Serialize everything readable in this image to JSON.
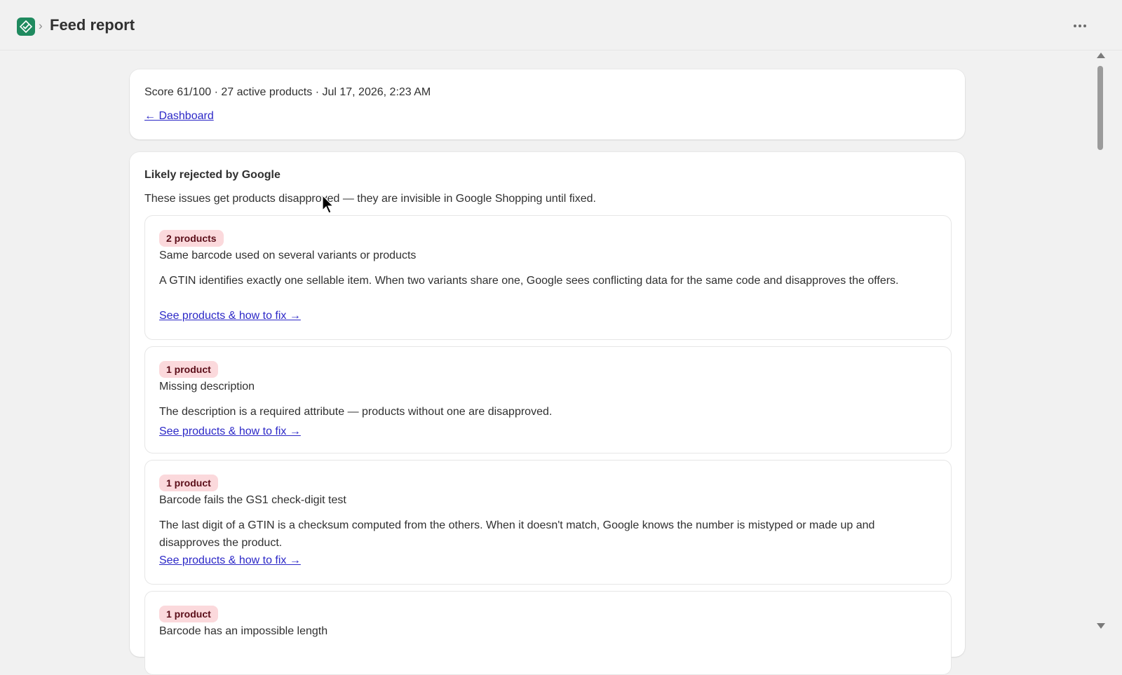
{
  "header": {
    "breadcrumb_sep": "›",
    "title": "Feed report"
  },
  "summary": {
    "line": "Score 61/100 · 27 active products · Jul 17, 2026, 2:23 AM",
    "dashboard_link": "← Dashboard"
  },
  "section": {
    "title": "Likely rejected by Google",
    "description": "These issues get products disapproved — they are invisible in Google Shopping until fixed."
  },
  "issues": [
    {
      "badge": "2 products",
      "title": "Same barcode used on several variants or products",
      "description": "A GTIN identifies exactly one sellable item. When two variants share one, Google sees conflicting data for the same code and disapproves the offers.",
      "link": "See products & how to fix →"
    },
    {
      "badge": "1 product",
      "title": "Missing description",
      "description": "The description is a required attribute — products without one are disapproved.",
      "link": "See products & how to fix →"
    },
    {
      "badge": "1 product",
      "title": "Barcode fails the GS1 check-digit test",
      "description": "The last digit of a GTIN is a checksum computed from the others. When it doesn't match, Google knows the number is mistyped or made up and disapproves the product.",
      "link": "See products & how to fix →"
    },
    {
      "badge": "1 product",
      "title": "Barcode has an impossible length"
    }
  ],
  "colors": {
    "badge_bg": "#fbd9dc",
    "link": "#2c28c7",
    "logo": "#1f8a5f"
  },
  "icons": {
    "logo": "app-logo-icon",
    "more": "more-horizontal-icon",
    "cursor": "mouse-pointer-icon"
  }
}
